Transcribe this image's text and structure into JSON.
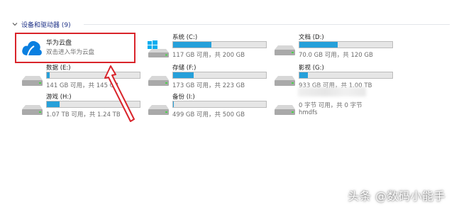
{
  "group": {
    "title": "设备和驱动器 (9)"
  },
  "cloud": {
    "name": "华为云盘",
    "subtitle": "双击进入华为云盘"
  },
  "drives": [
    {
      "name": "系统 (C:)",
      "used_fraction": 0.415,
      "detail": "117 GB 可用，共 200 GB",
      "icon": "windows-drive-icon"
    },
    {
      "name": "文档 (D:)",
      "used_fraction": 0.416,
      "detail": "70.0 GB 可用，共 120 GB",
      "icon": "drive-icon"
    },
    {
      "name": "数据 (E:)",
      "used_fraction": 0.027,
      "detail": "141 GB 可用，共 145 GB",
      "icon": "drive-icon"
    },
    {
      "name": "存储 (F:)",
      "used_fraction": 0.224,
      "detail": "173 GB 可用，共 223 GB",
      "icon": "drive-icon"
    },
    {
      "name": "影视 (G:)",
      "used_fraction": 0.089,
      "detail": "933 GB 可用，共 1.00 TB",
      "icon": "drive-icon"
    },
    {
      "name": "游戏 (H:)",
      "used_fraction": 0.137,
      "detail": "1.07 TB 可用，共 1.24 TB",
      "icon": "drive-icon"
    },
    {
      "name": "备份 (I:)",
      "used_fraction": 0.002,
      "detail": "499 GB 可用，共 500 GB",
      "icon": "drive-icon"
    }
  ],
  "network_drive": {
    "detail": "0 字节 可用，共 0 字节",
    "label": "hmdfs",
    "icon": "network-drive-icon"
  },
  "watermark": "头条 @数码小能手"
}
